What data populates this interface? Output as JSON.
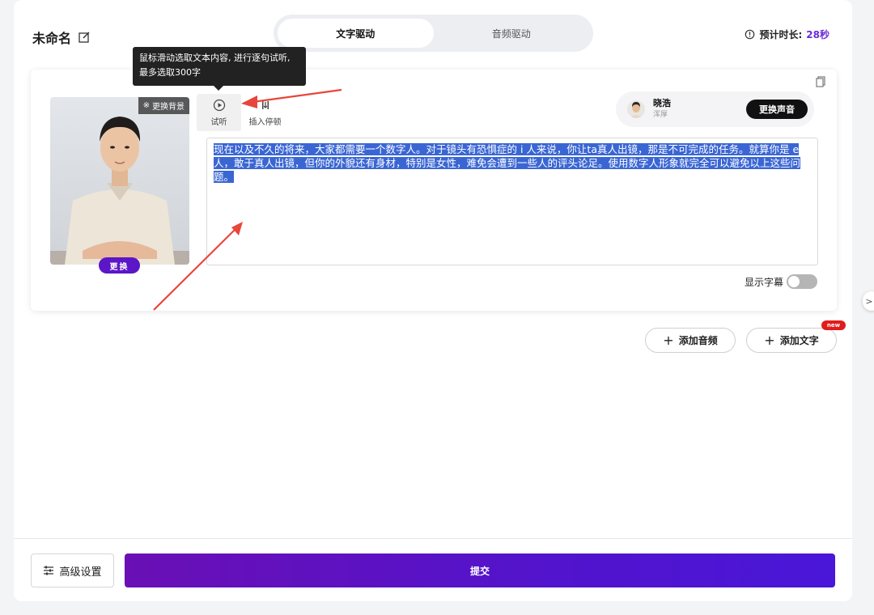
{
  "header": {
    "title": "未命名",
    "tabs": [
      {
        "label": "文字驱动",
        "active": true
      },
      {
        "label": "音频驱动",
        "active": false
      }
    ],
    "duration_label": "预计时长:",
    "duration_value": "28秒"
  },
  "avatar_card": {
    "change_background_label": "更换背景",
    "replace_label": "更换"
  },
  "toolbar": {
    "play_label": "试听",
    "insert_pause_label": "插入停顿"
  },
  "tooltip": {
    "line1": "鼠标滑动选取文本内容, 进行逐句试听,",
    "line2": "最多选取300字"
  },
  "voice": {
    "name": "晓浩",
    "style": "浑厚",
    "change_label": "更换声音"
  },
  "script_text": "现在以及不久的将来，大家都需要一个数字人。对于镜头有恐惧症的 i 人来说，你让ta真人出镜，那是不可完成的任务。就算你是 e 人，敢于真人出镜，但你的外貌还有身材，特别是女性，难免会遭到一些人的评头论足。使用数字人形象就完全可以避免以上这些问题。",
  "subtitle_toggle": {
    "label": "显示字幕",
    "enabled": false
  },
  "actions": {
    "add_audio_label": "添加音频",
    "add_text_label": "添加文字",
    "new_badge": "new"
  },
  "footer": {
    "advanced_label": "高级设置",
    "submit_label": "提交"
  },
  "colors": {
    "accent": "#5b16c8",
    "annotation_arrow": "#e8463a",
    "selection": "#3a66d4"
  }
}
